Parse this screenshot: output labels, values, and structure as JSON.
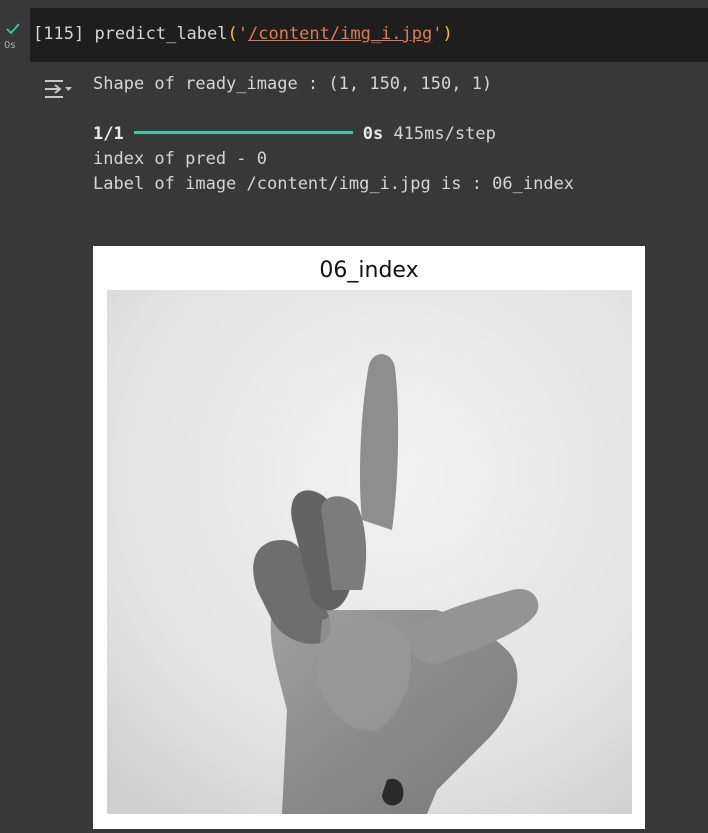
{
  "cell": {
    "status_icon": "check-icon",
    "exec_time": "0s",
    "exec_count": "[115]",
    "func_name": "predict_label",
    "open_paren": "(",
    "quote_open": "'",
    "path": "/content/img_i.jpg",
    "quote_close": "'",
    "close_paren": ")"
  },
  "output": {
    "icon": "output-toggle-icon",
    "shape_line": "Shape of ready_image : (1, 150, 150, 1)",
    "progress_count": "1/1",
    "progress_fraction": 1.0,
    "progress_time": "0s",
    "progress_step": "415ms/step",
    "index_line": "index of pred - 0",
    "label_line": "Label of image /content/img_i.jpg is : 06_index"
  },
  "figure": {
    "title": "06_index",
    "image_subject": "grayscale photo of a hand forming an L shape"
  },
  "colors": {
    "background": "#383838",
    "code_bg": "#1e1e1e",
    "accent_green": "#3ec7a6",
    "string": "#e07b53",
    "paren": "#f5c518"
  }
}
